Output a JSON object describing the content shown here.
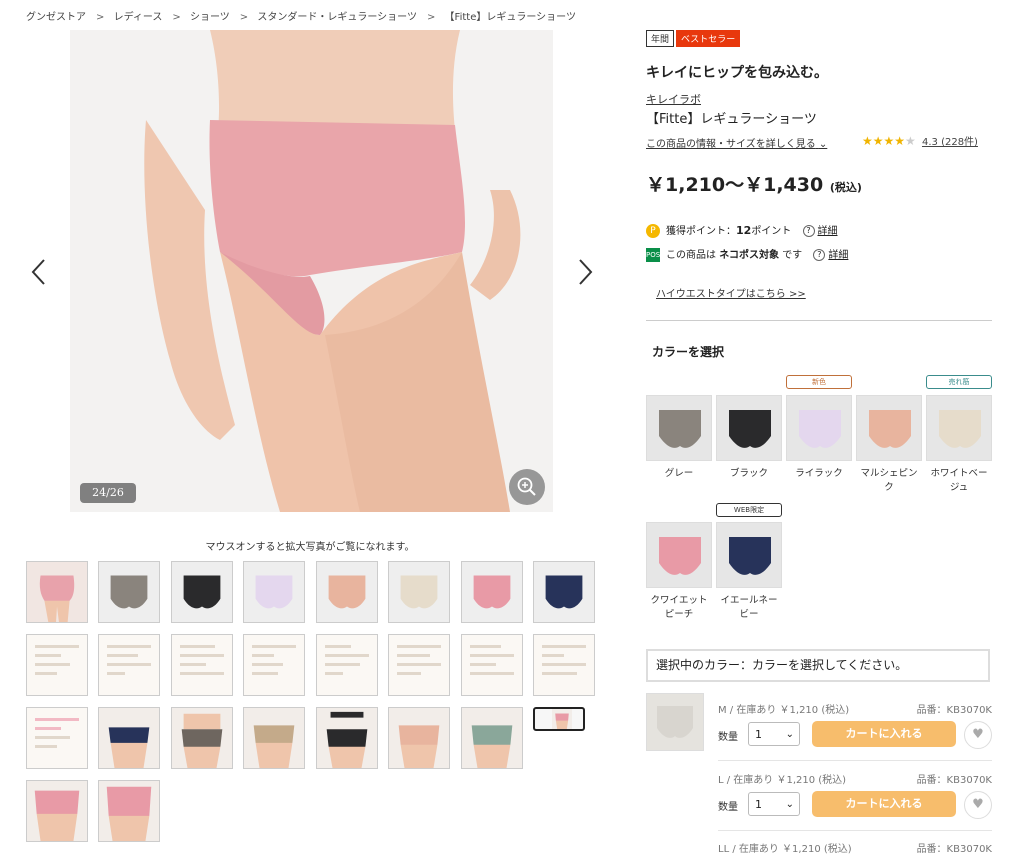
{
  "breadcrumb": [
    "グンゼストア",
    "レディース",
    "ショーツ",
    "スタンダード・レギュラーショーツ",
    "【Fitte】レギュラーショーツ"
  ],
  "breadcrumb_sep": ">",
  "gallery": {
    "counter": "24/26",
    "hint": "マウスオンすると拡大写真がご覧になれます。",
    "thumb_count": 26,
    "selected_index": 23
  },
  "product": {
    "badges": [
      "年間",
      "ベストセラー"
    ],
    "headline": "キレイにヒップを包み込む。",
    "brand": "キレイラボ",
    "name": "【Fitte】レギュラーショーツ",
    "info_link": "この商品の情報・サイズを詳しく見る",
    "rating_stars": 4.3,
    "rating_text": "4.3 (228件)",
    "price": "￥1,210〜￥1,430",
    "tax": "(税込)",
    "points_label": "獲得ポイント：",
    "points_value": "12",
    "points_unit": "ポイント",
    "detail": "詳細",
    "nekopos_pre": "この商品は",
    "nekopos_bold": "ネコポス対象",
    "nekopos_post": "です",
    "highwaist_link": "ハイウエストタイプはこちら >>",
    "color_heading": "カラーを選択",
    "colors": [
      {
        "name": "グレー",
        "hex": "#8a847d",
        "tag": ""
      },
      {
        "name": "ブラック",
        "hex": "#2a2a2c",
        "tag": ""
      },
      {
        "name": "ライラック",
        "hex": "#e4d7ee",
        "tag": "新色"
      },
      {
        "name": "マルシェピンク",
        "hex": "#e8b49e",
        "tag": ""
      },
      {
        "name": "ホワイトベージュ",
        "hex": "#e6dccb",
        "tag": "売れ筋"
      },
      {
        "name": "クワイエットピーチ",
        "hex": "#e89aa6",
        "tag": ""
      },
      {
        "name": "イエールネービー",
        "hex": "#27335a",
        "tag": "WEB限定"
      }
    ],
    "selected_color_text": "選択中のカラー：カラーを選択してください。",
    "qty_label": "数量",
    "cart_label": "カートに入れる",
    "code_label": "品番：KB3070K",
    "sizes": [
      {
        "size": "M / 在庫あり ￥1,210 (税込)",
        "qty": "1"
      },
      {
        "size": "L / 在庫あり ￥1,210 (税込)",
        "qty": "1"
      },
      {
        "size": "LL / 在庫あり ￥1,210 (税込)",
        "qty": ""
      }
    ]
  },
  "colors": {
    "accent_orange": "#f7bd6c",
    "best_red": "#e8380d",
    "star": "#f0b400",
    "tag_new": "#c0703a",
    "tag_sell": "#3a8c8c",
    "tag_web": "#333333"
  }
}
